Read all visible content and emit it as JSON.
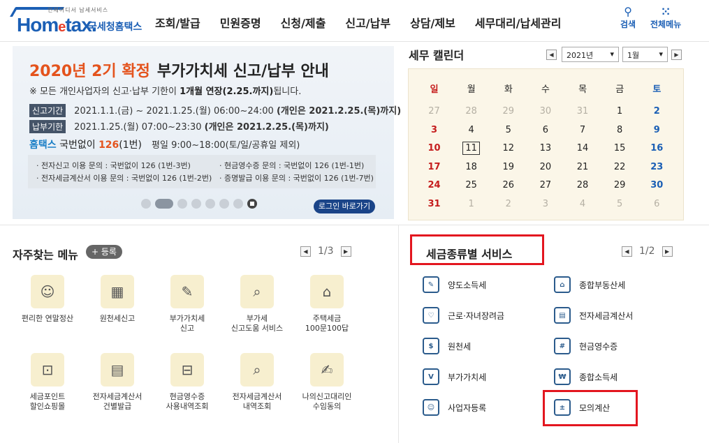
{
  "header": {
    "logo_small": "언제어디서 납세서비스",
    "logo_main": "Hom",
    "logo_e": "e",
    "logo_tail": "tax.",
    "logo_kr": "국세청홈택스",
    "nav": [
      "조회/발급",
      "민원증명",
      "신청/제출",
      "신고/납부",
      "상담/제보",
      "세무대리/납세관리"
    ],
    "search_label": "검색",
    "menu_label": "전체메뉴"
  },
  "banner": {
    "title_orange": "2020년 2기 확정",
    "title_black": "부가가치세 신고/납부 안내",
    "notice_pre": "※ 모든 개인사업자의 신고·납부 기한이 ",
    "notice_bold": "1개월 연장(2.25.까지)",
    "notice_post": "됩니다.",
    "report_tag": "신고기간",
    "report_text": "2021.1.1.(금) ~ 2021.1.25.(월) 06:00~24:00 ",
    "report_bold": "(개인은 2021.2.25.(목)까지)",
    "pay_tag": "납부기한",
    "pay_text": "2021.1.25.(월) 07:00~23:30 ",
    "pay_bold": "(개인은 2021.2.25.(목)까지)",
    "hometax_label": "홈택스",
    "hometax_text": " 국번없이 ",
    "hometax_num": "126",
    "hometax_suffix": "(1번)",
    "hours": "평일 9:00~18:00(토/일/공휴일 제외)",
    "info": [
      "· 전자신고 이용 문의 : 국번없이 126 (1번-3번)",
      "· 현금영수증 문의 : 국번없이 126 (1번-1번)",
      "· 전자세금계산서 이용 문의 : 국번없이 126 (1번-2번)",
      "· 증명발급 이용 문의 : 국번없이 126 (1번-7번)"
    ],
    "login_button": "로그인 바로가기"
  },
  "calendar": {
    "title": "세무 캘린더",
    "year": "2021년",
    "month": "1월",
    "weekdays": [
      "일",
      "월",
      "화",
      "수",
      "목",
      "금",
      "토"
    ],
    "weeks": [
      [
        "27",
        "28",
        "29",
        "30",
        "31",
        "1",
        "2"
      ],
      [
        "3",
        "4",
        "5",
        "6",
        "7",
        "8",
        "9"
      ],
      [
        "10",
        "11",
        "12",
        "13",
        "14",
        "15",
        "16"
      ],
      [
        "17",
        "18",
        "19",
        "20",
        "21",
        "22",
        "23"
      ],
      [
        "24",
        "25",
        "26",
        "27",
        "28",
        "29",
        "30"
      ],
      [
        "31",
        "1",
        "2",
        "3",
        "4",
        "5",
        "6"
      ]
    ],
    "today": "11"
  },
  "favorites": {
    "title": "자주찾는 메뉴",
    "register_button": "+ 등록",
    "page": "1/3",
    "items": [
      "편리한 연말정산",
      "원천세신고",
      "부가가치세\n신고",
      "부가세\n신고도움 서비스",
      "주택세금\n100문100답",
      "세금포인트\n할인쇼핑몰",
      "전자세금계산서\n건별발급",
      "현금영수증\n사용내역조회",
      "전자세금계산서\n내역조회",
      "나의신고대리인\n수임동의"
    ]
  },
  "tax_services": {
    "title": "세금종류별 서비스",
    "page": "1/2",
    "items": [
      "양도소득세",
      "종합부동산세",
      "근로·자녀장려금",
      "전자세금계산서",
      "원천세",
      "현금영수증",
      "부가가치세",
      "종합소득세",
      "사업자등록",
      "모의계산"
    ]
  },
  "colors": {
    "brand": "#1b5fb5",
    "orange": "#e4531d",
    "highlight_red": "#e3161f"
  }
}
